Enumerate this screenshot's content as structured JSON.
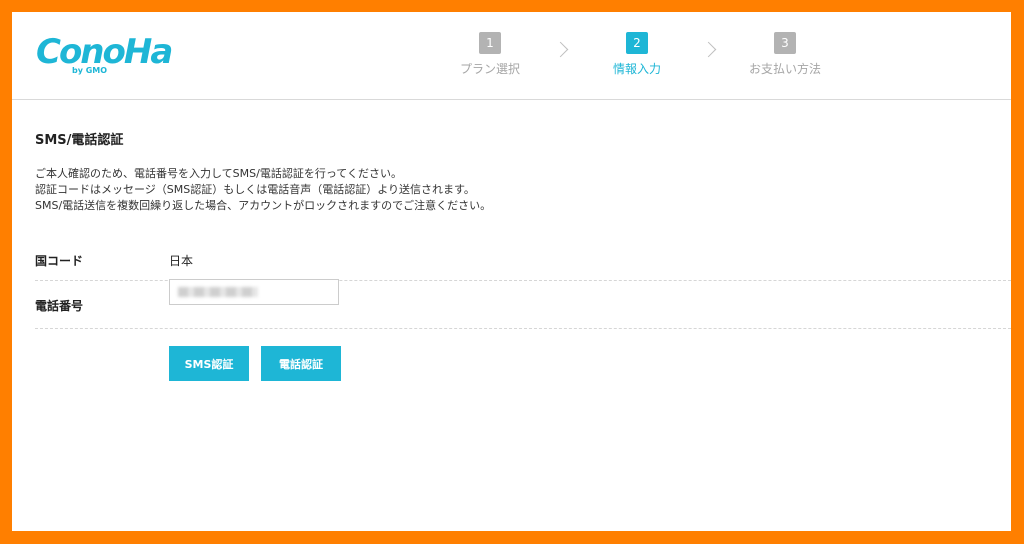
{
  "brand": {
    "logo_text": "ConoHa",
    "logo_sub": "by GMO",
    "color": "#1eb6d6"
  },
  "steps": [
    {
      "number": "1",
      "label": "プラン選択",
      "active": false
    },
    {
      "number": "2",
      "label": "情報入力",
      "active": true
    },
    {
      "number": "3",
      "label": "お支払い方法",
      "active": false
    }
  ],
  "section": {
    "title": "SMS/電話認証",
    "description": [
      "ご本人確認のため、電話番号を入力してSMS/電話認証を行ってください。",
      "認証コードはメッセージ（SMS認証）もしくは電話音声（電話認証）より送信されます。",
      "SMS/電話送信を複数回繰り返した場合、アカウントがロックされますのでご注意ください。"
    ]
  },
  "form": {
    "country_label": "国コード",
    "country_value": "日本",
    "phone_label": "電話番号"
  },
  "buttons": {
    "sms": "SMS認証",
    "call": "電話認証"
  },
  "frame_color": "#ff7f00"
}
